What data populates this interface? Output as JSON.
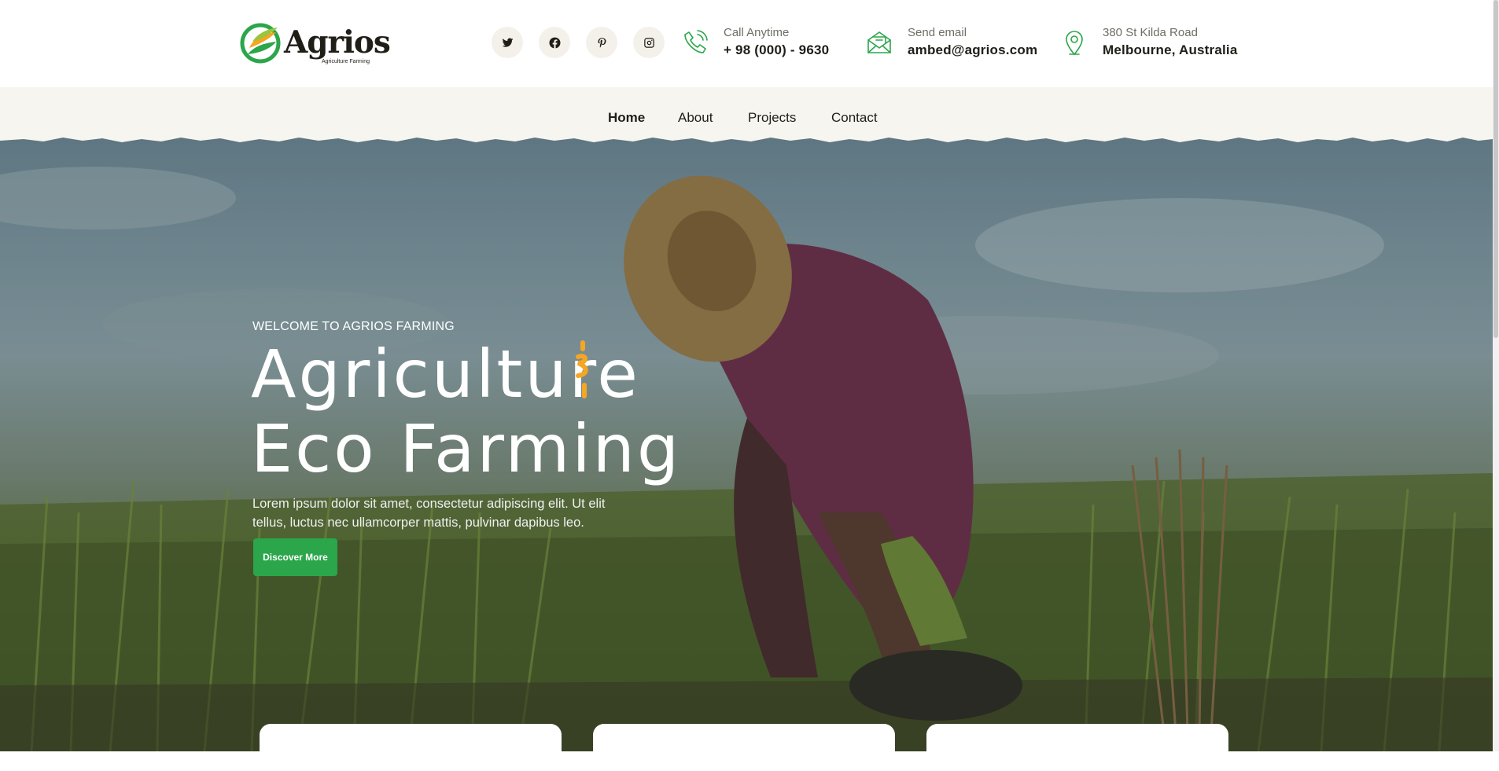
{
  "brand": {
    "name": "Agrios",
    "tagline": "Agriculture Farming"
  },
  "social": [
    "twitter-icon",
    "facebook-icon",
    "pinterest-icon",
    "instagram-icon"
  ],
  "contacts": {
    "phone": {
      "label": "Call Anytime",
      "value": "+ 98 (000) - 9630",
      "icon": "phone-icon"
    },
    "email": {
      "label": "Send email",
      "value": "ambed@agrios.com",
      "icon": "mail-icon"
    },
    "address": {
      "label": "380 St Kilda Road",
      "value": "Melbourne, Australia",
      "icon": "location-icon"
    }
  },
  "nav": {
    "home": "Home",
    "about": "About",
    "projects": "Projects",
    "contact": "Contact",
    "active": "Home"
  },
  "hero": {
    "subtitle": "WELCOME TO AGRIOS FARMING",
    "title_line1": "Agriculture",
    "title_line2": "Eco Farming",
    "description": "Lorem ipsum dolor sit amet, consectetur adipiscing elit. Ut elit tellus, luctus nec ullamcorper mattis, pulvinar dapibus leo.",
    "button": "Discover More"
  },
  "colors": {
    "accent": "#2ba64b",
    "highlight": "#f5a623",
    "dark": "#1f1e17",
    "nav_bg": "#f7f5f0"
  }
}
